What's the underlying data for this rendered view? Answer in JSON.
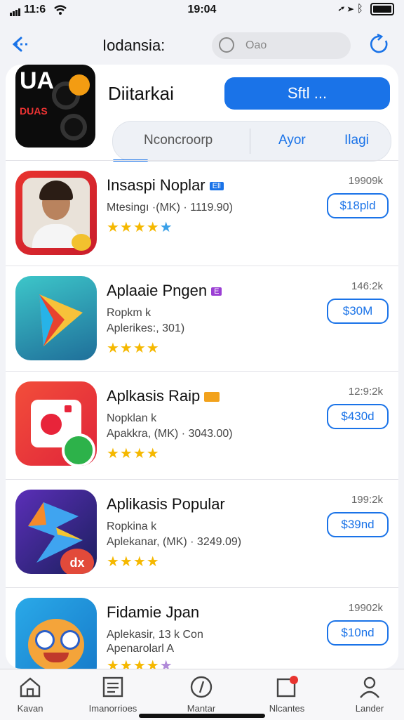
{
  "status": {
    "left": "11:6",
    "time": "19:04"
  },
  "nav": {
    "title": "Iodansia:",
    "search_placeholder": "Oao"
  },
  "hero": {
    "icon_text": "UA",
    "icon_subtext": "DUAS",
    "name": "Diitarkai",
    "get_label": "Sftl ..."
  },
  "tabs": [
    "Nconcroorp",
    "Ayor",
    "Ilagi"
  ],
  "apps": [
    {
      "name": "Insaspi Noplar",
      "meta1": "Mtesingı ·(MK) · 1119.90)",
      "meta2": "",
      "rating": "★★★★",
      "size": "19909k",
      "price": "$18pld",
      "badge": "Ell",
      "badge_color": "#1a73e8"
    },
    {
      "name": "Aplaaie Pngen",
      "meta1": "Ropkm k",
      "meta2": "Aplerikes:, 301)",
      "rating": "★★★★",
      "size": "146:2k",
      "price": "$30M",
      "badge": "E",
      "badge_color": "#9b3fd4"
    },
    {
      "name": "Aplkasis Raip",
      "meta1": "Nopklan k",
      "meta2": "Apakkra, (MK) · 3043.00)",
      "rating": "★★★★",
      "size": "12:9:2k",
      "price": "$430d",
      "badge": "",
      "badge_color": "#f2a21c"
    },
    {
      "name": "Aplikasis Popular",
      "meta1": "Ropkina k",
      "meta2": "Aplekanar, (MK) · 3249.09)",
      "rating": "★★★★",
      "size": "199:2k",
      "price": "$39nd",
      "badge": "",
      "badge_color": ""
    },
    {
      "name": "Fidamie Jpan",
      "meta1": "Aplekasir, 13 k Con",
      "meta2": "Apenarolarl A",
      "rating": "★★★★",
      "size": "19902k",
      "price": "$10nd",
      "badge": "",
      "badge_color": ""
    }
  ],
  "tabbar": [
    "Kavan",
    "Imanorrioes",
    "Mantar",
    "Nlcantes",
    "Lander"
  ]
}
